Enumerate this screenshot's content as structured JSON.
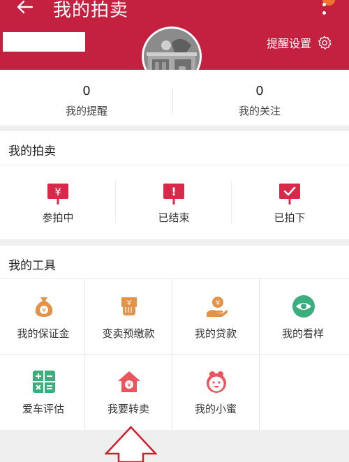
{
  "header": {
    "title": "我的拍卖",
    "remind_setting_label": "提醒设置",
    "icons": [
      "back-arrow-icon",
      "more-vertical-icon",
      "gear-icon"
    ],
    "accent_color": "#c4203f"
  },
  "stats": [
    {
      "value": "0",
      "label": "我的提醒"
    },
    {
      "value": "0",
      "label": "我的关注"
    }
  ],
  "auction": {
    "title": "我的拍卖",
    "items": [
      {
        "label": "参拍中",
        "icon": "yen-sign-icon"
      },
      {
        "label": "已结束",
        "icon": "exclamation-sign-icon"
      },
      {
        "label": "已拍下",
        "icon": "check-sign-icon"
      }
    ]
  },
  "tools": {
    "title": "我的工具",
    "items": [
      {
        "label": "我的保证金",
        "icon": "money-bag-icon"
      },
      {
        "label": "变卖预缴款",
        "icon": "hand-cash-icon"
      },
      {
        "label": "我的贷款",
        "icon": "hand-coin-icon"
      },
      {
        "label": "我的看样",
        "icon": "eye-icon"
      },
      {
        "label": "爱车评估",
        "icon": "calculator-icon"
      },
      {
        "label": "我要转卖",
        "icon": "house-yen-icon"
      },
      {
        "label": "我的小蜜",
        "icon": "assistant-face-icon"
      }
    ]
  }
}
